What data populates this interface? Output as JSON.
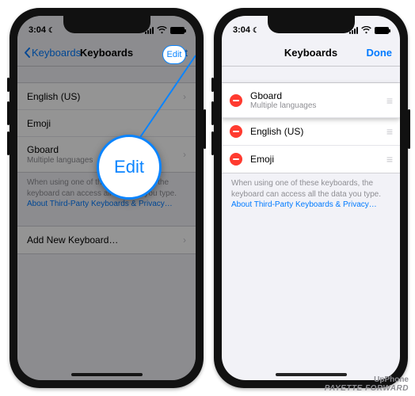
{
  "status": {
    "time": "3:04",
    "moon_icon": "moon-icon"
  },
  "left": {
    "nav": {
      "back_label": "Keyboards",
      "title": "Keyboards",
      "right_label": "Edit"
    },
    "rows": {
      "english": {
        "label": "English (US)"
      },
      "emoji": {
        "label": "Emoji"
      },
      "gboard": {
        "label": "Gboard",
        "sub": "Multiple languages"
      }
    },
    "footnote": {
      "text": "When using one of these keyboards, the keyboard can access all the data you type. ",
      "link": "About Third-Party Keyboards & Privacy…"
    },
    "add_row": {
      "label": "Add New Keyboard…"
    },
    "magnifier_label": "Edit"
  },
  "right": {
    "nav": {
      "title": "Keyboards",
      "done_label": "Done"
    },
    "rows": {
      "gboard": {
        "label": "Gboard",
        "sub": "Multiple languages"
      },
      "english": {
        "label": "English (US)"
      },
      "emoji": {
        "label": "Emoji"
      }
    },
    "footnote": {
      "text": "When using one of these keyboards, the keyboard can access all the data you type. ",
      "link": "About Third-Party Keyboards & Privacy…"
    }
  },
  "watermark": {
    "line1": "UpPhone",
    "line2": "PAYETTE FORWARD"
  },
  "colors": {
    "ios_blue": "#007aff",
    "ios_red": "#ff3b30"
  }
}
